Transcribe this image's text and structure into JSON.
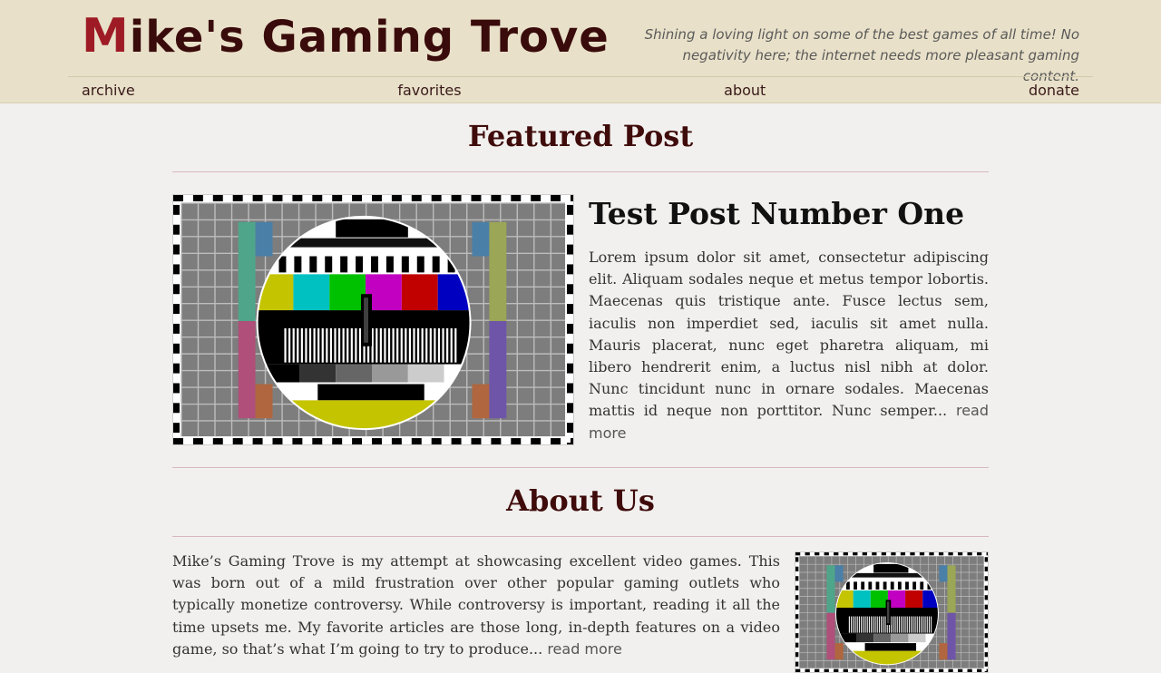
{
  "header": {
    "title_first": "M",
    "title_rest": "ike's Gaming Trove",
    "tagline": "Shining a loving light on some of the best games of all time! No negativity here; the internet needs more pleasant gaming content."
  },
  "nav": {
    "items": [
      {
        "label": "archive"
      },
      {
        "label": "favorites"
      },
      {
        "label": "about"
      },
      {
        "label": "donate"
      }
    ]
  },
  "featured": {
    "heading": "Featured Post",
    "post_title": "Test Post Number One",
    "excerpt": "Lorem ipsum dolor sit amet, consectetur adipiscing elit. Aliquam sodales neque et metus tempor lobortis. Maecenas quis tristique ante. Fusce lectus sem, iaculis non imperdiet sed, iaculis sit amet nulla. Mauris placerat, nunc eget pharetra aliquam, mi libero hendrerit enim, a luctus nisl nibh at dolor. Nunc tincidunt nunc in ornare sodales. Maecenas mattis id neque non porttitor. Nunc semper...",
    "read_more": "read more",
    "image": "tv-test-pattern"
  },
  "about": {
    "heading": "About Us",
    "text": "Mike’s Gaming Trove is my attempt at showcasing excellent video games. This was born out of a mild frustration over other popular gaming outlets who typically monetize controversy. While controversy is important, reading it all the time upsets me. My favorite articles are those long, in-depth features on a video game, so that’s what I’m going to try to produce...",
    "read_more": "read more",
    "image": "tv-test-pattern"
  },
  "colors": {
    "header_bg": "#e8e0c8",
    "title_dark": "#3a0b0b",
    "title_accent": "#9e1b26",
    "page_bg": "#f1f0ee",
    "rule": "#d8b7bf"
  }
}
